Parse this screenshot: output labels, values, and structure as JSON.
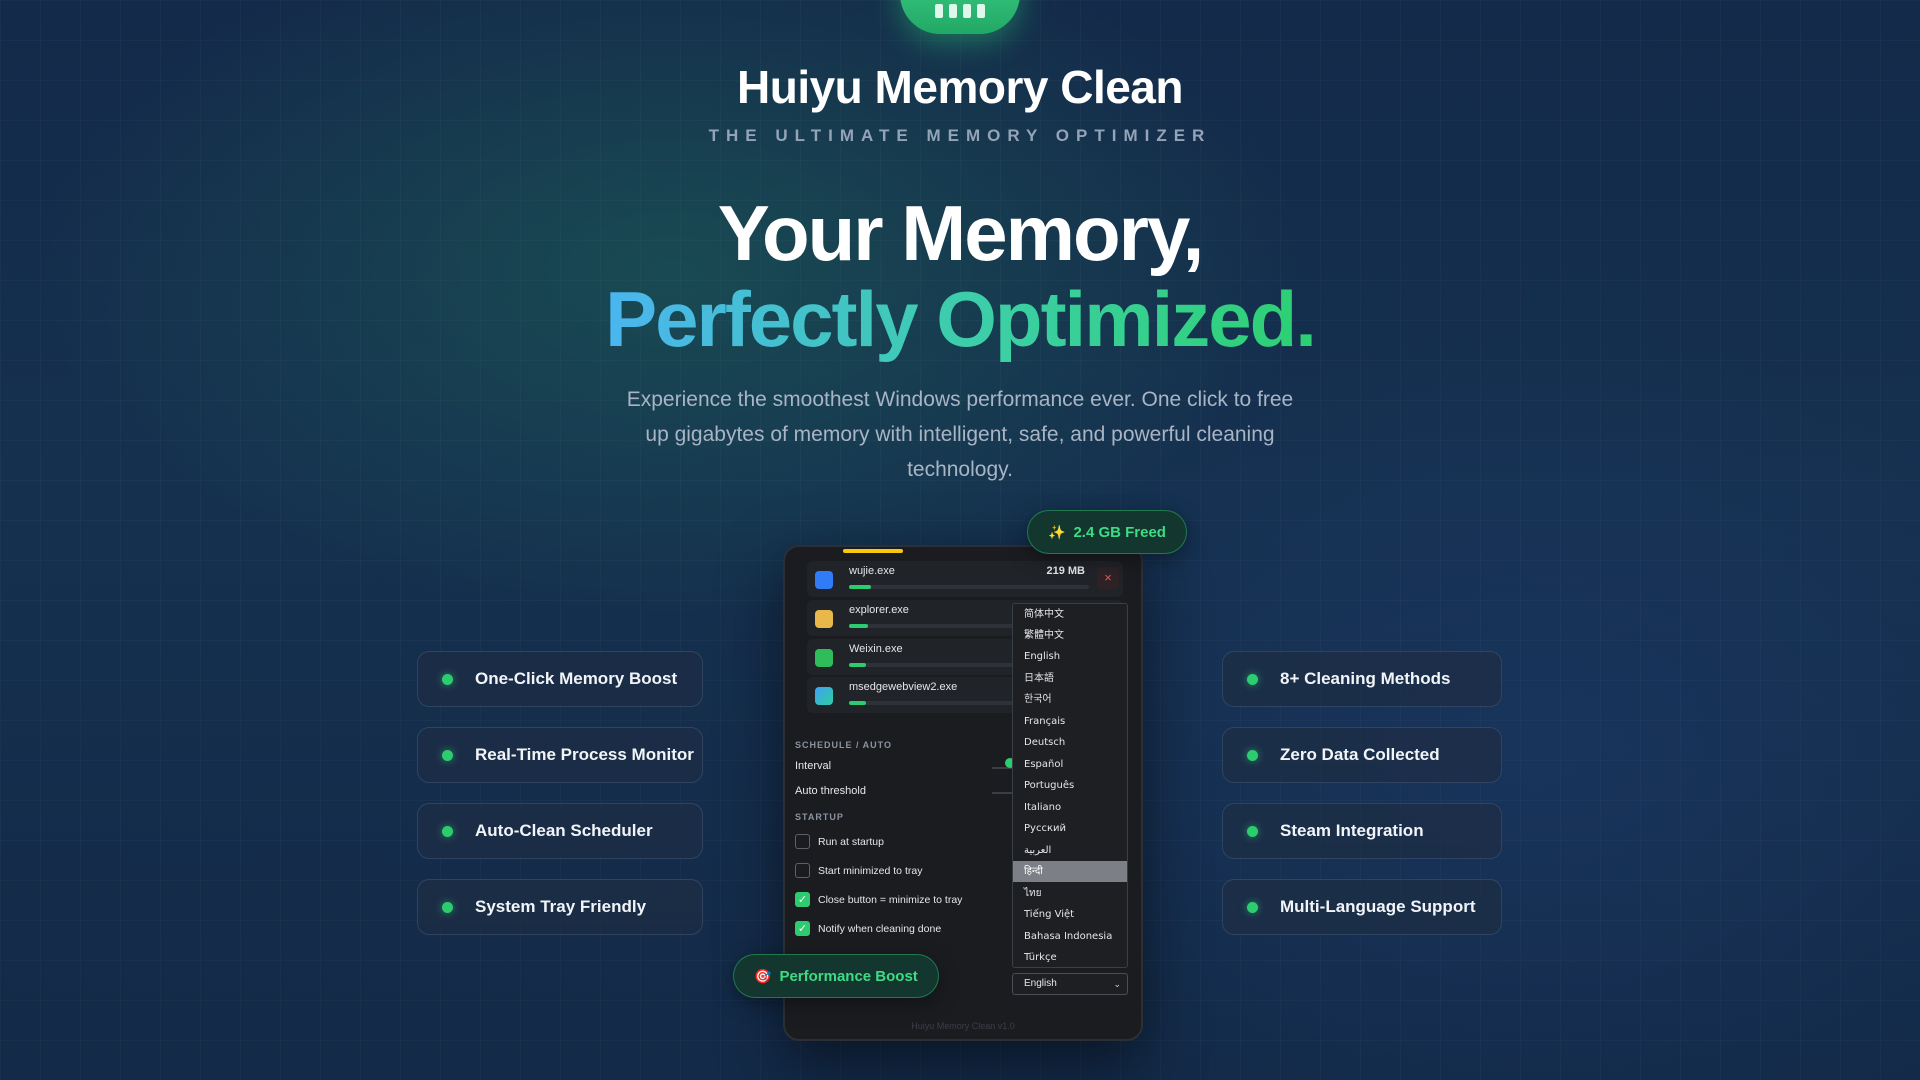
{
  "brand": {
    "title": "Huiyu Memory Clean",
    "tagline": "THE ULTIMATE MEMORY OPTIMIZER"
  },
  "hero": {
    "line1": "Your Memory,",
    "line2": "Perfectly Optimized.",
    "subtitle": "Experience the smoothest Windows performance ever. One click to free up gigabytes of memory with intelligent, safe, and powerful cleaning technology."
  },
  "features_left": [
    "One-Click Memory Boost",
    "Real-Time Process Monitor",
    "Auto-Clean Scheduler",
    "System Tray Friendly"
  ],
  "features_right": [
    "8+ Cleaning Methods",
    "Zero Data Collected",
    "Steam Integration",
    "Multi-Language Support"
  ],
  "badges": {
    "freed": "2.4 GB Freed",
    "boost": "Performance Boost",
    "freed_icon": "sparkle-icon",
    "boost_icon": "target-icon"
  },
  "app": {
    "processes": [
      {
        "name": "wujie.exe",
        "size": "219 MB",
        "icon": "wujie-icon",
        "usage": 0.09
      },
      {
        "name": "explorer.exe",
        "size": "",
        "icon": "folder-icon",
        "usage": 0.08
      },
      {
        "name": "Weixin.exe",
        "size": "",
        "icon": "wechat-icon",
        "usage": 0.07
      },
      {
        "name": "msedgewebview2.exe",
        "size": "",
        "icon": "edge-icon",
        "usage": 0.07
      }
    ],
    "schedule_label": "SCHEDULE / AUTO",
    "interval_label": "Interval",
    "threshold_label": "Auto threshold",
    "startup_label": "STARTUP",
    "startup_options": [
      {
        "label": "Run at startup",
        "checked": false
      },
      {
        "label": "Start minimized to tray",
        "checked": false
      },
      {
        "label": "Close button = minimize to tray",
        "checked": true
      },
      {
        "label": "Notify when cleaning done",
        "checked": true
      }
    ],
    "footer": "Huiyu Memory Clean v1.0"
  },
  "language": {
    "options": [
      "简体中文",
      "繁體中文",
      "English",
      "日本語",
      "한국어",
      "Français",
      "Deutsch",
      "Español",
      "Português",
      "Italiano",
      "Русский",
      "العربية",
      "हिन्दी",
      "ไทย",
      "Tiếng Việt",
      "Bahasa Indonesia",
      "Türkçe"
    ],
    "highlighted": "हिन्दी",
    "selected": "English"
  },
  "colors": {
    "accent_green": "#2ecc71",
    "accent_blue": "#4bb5f0",
    "progress_yellow": "#f6c90e"
  }
}
